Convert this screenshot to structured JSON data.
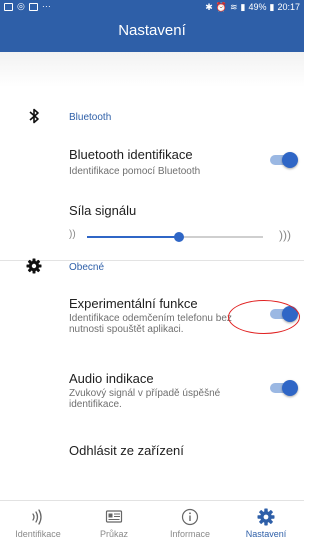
{
  "status_bar": {
    "battery": "49%",
    "time": "20:17"
  },
  "header": {
    "title": "Nastavení"
  },
  "sections": {
    "bluetooth": {
      "title": "Bluetooth",
      "identification": {
        "title": "Bluetooth identifikace",
        "subtitle": "Identifikace pomocí Bluetooth",
        "enabled": true
      },
      "signal": {
        "title": "Síla signálu",
        "low_glyph": "))",
        "high_glyph": ")))",
        "level": 0.52
      }
    },
    "general": {
      "title": "Obecné",
      "experimental": {
        "title": "Experimentální funkce",
        "subtitle": "Identifikace odemčením telefonu bez nutnosti spouštět aplikaci.",
        "enabled": true
      },
      "audio": {
        "title": "Audio indikace",
        "subtitle": "Zvukový signál v případě úspěšné identifikace.",
        "enabled": true
      },
      "logout": {
        "title": "Odhlásit ze zařízení"
      }
    }
  },
  "bottom_nav": {
    "items": [
      {
        "label": "Identifikace",
        "icon": "signal-waves-icon"
      },
      {
        "label": "Průkaz",
        "icon": "id-card-icon"
      },
      {
        "label": "Informace",
        "icon": "info-icon"
      },
      {
        "label": "Nastavení",
        "icon": "gear-icon"
      }
    ],
    "active_index": 3
  },
  "colors": {
    "primary": "#2e5fa8",
    "accent": "#2f66c6",
    "annotation": "#e02020"
  }
}
